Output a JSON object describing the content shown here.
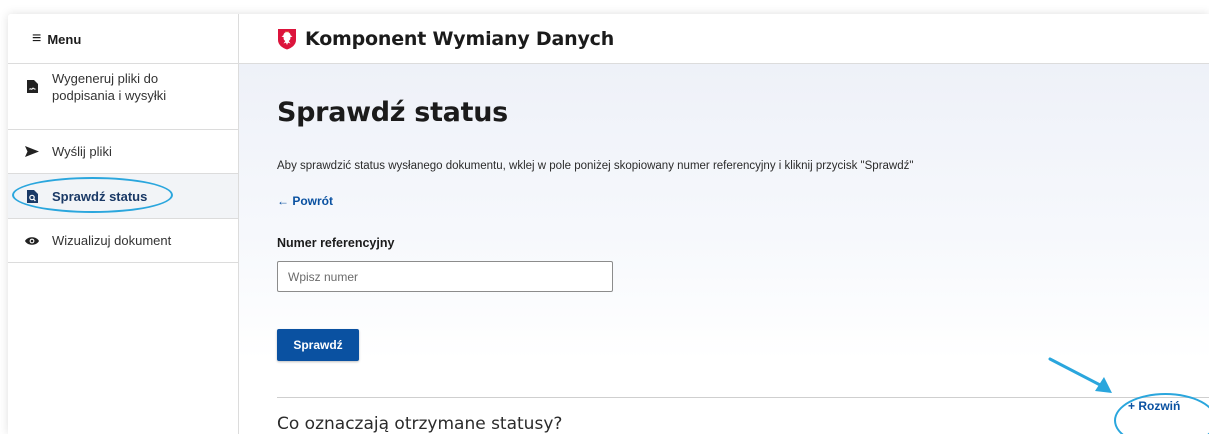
{
  "header": {
    "menu_label": "Menu",
    "title": "Komponent Wymiany Danych"
  },
  "sidebar": {
    "items": [
      {
        "label": "Wygeneruj pliki do podpisania i wysyłki",
        "icon": "document-signature-icon",
        "active": false
      },
      {
        "label": "Wyślij pliki",
        "icon": "send-icon",
        "active": false
      },
      {
        "label": "Sprawdź status",
        "icon": "document-search-icon",
        "active": true
      },
      {
        "label": "Wizualizuj dokument",
        "icon": "eye-icon",
        "active": false
      }
    ]
  },
  "main": {
    "title": "Sprawdź status",
    "description": "Aby sprawdzić status wysłanego dokumentu, wklej w pole poniżej skopiowany numer referencyjny i kliknij przycisk \"Sprawdź\"",
    "back_label": "← Powrót",
    "field_label": "Numer referencyjny",
    "field_placeholder": "Wpisz numer",
    "field_value": "",
    "submit_label": "Sprawdź",
    "faq_question": "Co oznaczają otrzymane statusy?",
    "expand_label": "+ Rozwiń"
  },
  "colors": {
    "primary": "#0a51a1",
    "annotation": "#2aa6dd",
    "active_text": "#1a3966",
    "emblem_red": "#dc143c"
  }
}
